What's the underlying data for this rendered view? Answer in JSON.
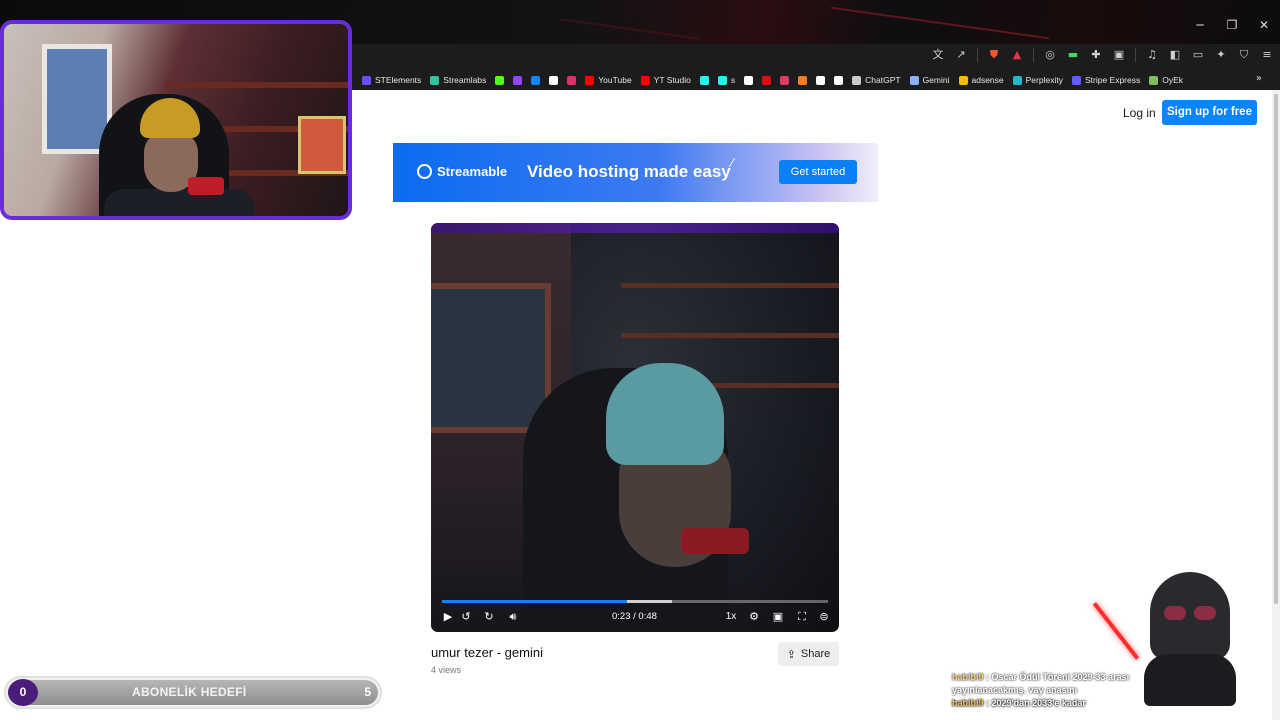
{
  "browser": {
    "bookmarks": [
      {
        "label": "STElements",
        "color": "#6b4cf5"
      },
      {
        "label": "Streamlabs",
        "color": "#31c3a2"
      },
      {
        "label": "",
        "color": "#53fc18"
      },
      {
        "label": "",
        "color": "#9146ff"
      },
      {
        "label": "",
        "color": "#1185fe"
      },
      {
        "label": "",
        "color": "#ffffff"
      },
      {
        "label": "",
        "color": "#e1306c"
      },
      {
        "label": "YouTube",
        "color": "#ff0000"
      },
      {
        "label": "YT Studio",
        "color": "#ff0000"
      },
      {
        "label": "",
        "color": "#25f4ee"
      },
      {
        "label": "s",
        "color": "#25f4ee"
      },
      {
        "label": "",
        "color": "#ffffff"
      },
      {
        "label": "",
        "color": "#e50914"
      },
      {
        "label": "",
        "color": "#e03a5f"
      },
      {
        "label": "",
        "color": "#f57c1f"
      },
      {
        "label": "",
        "color": "#ffffff"
      },
      {
        "label": "",
        "color": "#ffffff"
      },
      {
        "label": "ChatGPT",
        "color": "#cccccc"
      },
      {
        "label": "Gemini",
        "color": "#8ab4f8"
      },
      {
        "label": "adsense",
        "color": "#fbbc04"
      },
      {
        "label": "Perplexity",
        "color": "#20b8cd"
      },
      {
        "label": "Stripe Express",
        "color": "#635bff"
      },
      {
        "label": "OyEk",
        "color": "#7fbf5a"
      }
    ]
  },
  "header": {
    "login": "Log in",
    "signup": "Sign up for free"
  },
  "banner": {
    "brand": "Streamable",
    "tagline": "Video hosting made easy",
    "cta": "Get started"
  },
  "player": {
    "current_time": "0:23",
    "duration": "0:48",
    "time_display": "0:23 / 0:48",
    "played_fraction": 0.48,
    "buffered_fraction": 0.595,
    "speed": "1x"
  },
  "video": {
    "title": "umur tezer - gemini",
    "views": "4 views",
    "share": "Share"
  },
  "overlay": {
    "goal": {
      "current": "0",
      "label": "ABONELİK HEDEFİ",
      "target": "5"
    },
    "chat": [
      {
        "user": "habibi9",
        "text": " : Oscar Ödül Töreni 2029-33 arası yayınlanacakmış. vay anasını"
      },
      {
        "user": "habibi9",
        "text": " : 2029'dan 2033'e kadar"
      }
    ]
  },
  "colors": {
    "accent": "#0a84ff",
    "webcam_border": "#6a2cd9"
  }
}
